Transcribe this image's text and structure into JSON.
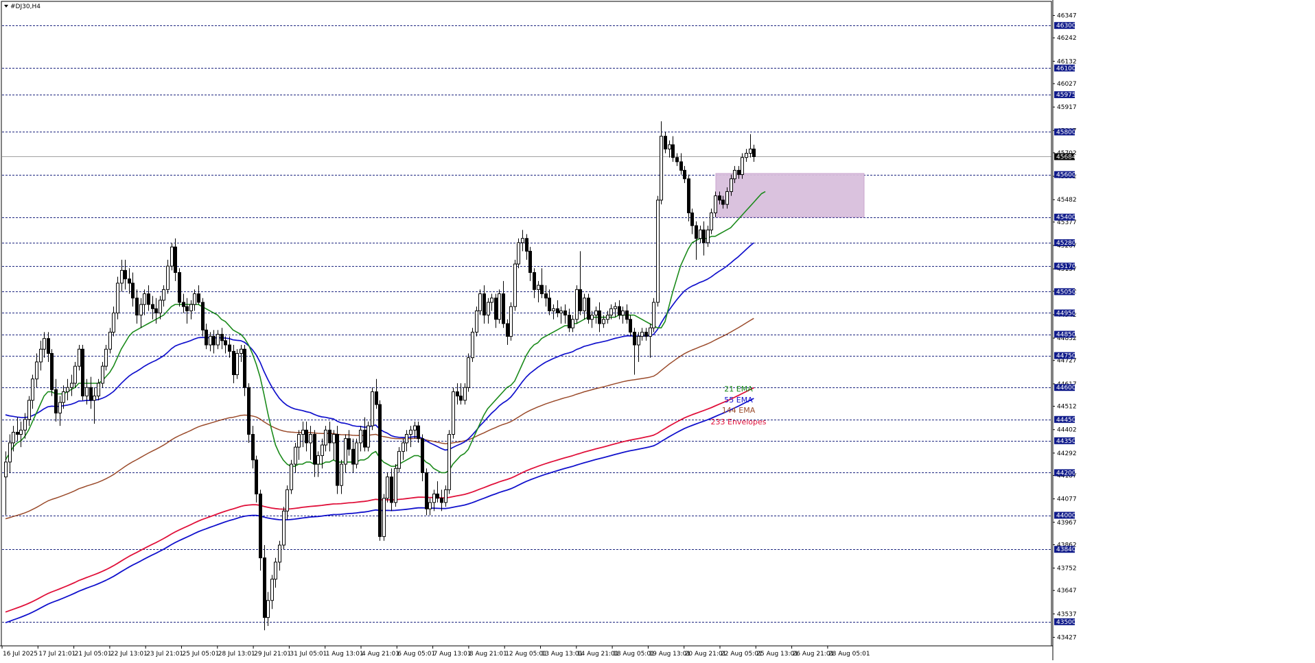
{
  "window": {
    "symbol_title": "#DJ30,H4",
    "menu_icon": "triangle-down-icon"
  },
  "colors": {
    "background": "#ffffff",
    "frame": "#000000",
    "bull_fill": "#ffffff",
    "bear_fill": "#000000",
    "ema21": "#1a8a1a",
    "ema55": "#1010cc",
    "ema144": "#9a4a2a",
    "env233_upper": "#e0103a",
    "env233_lower": "#1010cc",
    "level_line": "#1a237e",
    "level_label_bg": "#0f1a8a",
    "zone_fill": "#d8bfdc",
    "current_price_line": "#a0a0a0"
  },
  "chart_data": {
    "type": "candlestick",
    "title": "#DJ30,H4",
    "ylim": [
      43390,
      46410
    ],
    "y_ticks": [
      46347,
      46242,
      46132,
      46027,
      45917,
      45807,
      45702,
      45592,
      45482,
      45377,
      45267,
      45157,
      45052,
      44942,
      44832,
      44727,
      44617,
      44512,
      44402,
      44292,
      44187,
      44077,
      43967,
      43862,
      43752,
      43647,
      43537,
      43427
    ],
    "levels": [
      46300,
      46100,
      45975,
      45800,
      45600,
      45400,
      45280,
      45170,
      45050,
      44950,
      44850,
      44750,
      44600,
      44450,
      44350,
      44200,
      44000,
      43840,
      43500
    ],
    "current_price": 45684,
    "zone": {
      "from_date": "22 Aug 05:01",
      "to_date": "28 Aug 13:01",
      "low": 45400,
      "high": 45605
    },
    "x_labels": [
      "16 Jul 2025",
      "17 Jul 21:01",
      "21 Jul 05:01",
      "22 Jul 13:01",
      "23 Jul 21:01",
      "25 Jul 05:01",
      "28 Jul 13:01",
      "29 Jul 21:01",
      "31 Jul 05:01",
      "1 Aug 13:01",
      "4 Aug 21:01",
      "6 Aug 05:01",
      "7 Aug 13:01",
      "8 Aug 21:01",
      "12 Aug 05:01",
      "13 Aug 13:01",
      "14 Aug 21:01",
      "18 Aug 05:01",
      "19 Aug 13:01",
      "20 Aug 21:01",
      "22 Aug 05:01",
      "25 Aug 13:01",
      "26 Aug 21:01",
      "28 Aug 05:01"
    ],
    "candles": [
      [
        44180,
        44300,
        44000,
        44250
      ],
      [
        44250,
        44380,
        44200,
        44340
      ],
      [
        44340,
        44420,
        44300,
        44390
      ],
      [
        44390,
        44460,
        44350,
        44380
      ],
      [
        44380,
        44440,
        44320,
        44400
      ],
      [
        44400,
        44480,
        44360,
        44450
      ],
      [
        44450,
        44560,
        44420,
        44540
      ],
      [
        44540,
        44660,
        44500,
        44640
      ],
      [
        44640,
        44760,
        44600,
        44720
      ],
      [
        44720,
        44820,
        44680,
        44780
      ],
      [
        44780,
        44860,
        44740,
        44830
      ],
      [
        44830,
        44860,
        44720,
        44760
      ],
      [
        44760,
        44780,
        44560,
        44590
      ],
      [
        44590,
        44640,
        44440,
        44480
      ],
      [
        44480,
        44560,
        44420,
        44530
      ],
      [
        44530,
        44610,
        44500,
        44580
      ],
      [
        44580,
        44640,
        44540,
        44600
      ],
      [
        44600,
        44660,
        44560,
        44620
      ],
      [
        44620,
        44720,
        44600,
        44700
      ],
      [
        44700,
        44800,
        44680,
        44780
      ],
      [
        44780,
        44800,
        44540,
        44560
      ],
      [
        44560,
        44640,
        44520,
        44600
      ],
      [
        44600,
        44650,
        44500,
        44540
      ],
      [
        44540,
        44600,
        44430,
        44560
      ],
      [
        44560,
        44640,
        44540,
        44620
      ],
      [
        44620,
        44720,
        44600,
        44700
      ],
      [
        44700,
        44800,
        44680,
        44780
      ],
      [
        44780,
        44880,
        44760,
        44860
      ],
      [
        44860,
        44980,
        44840,
        44950
      ],
      [
        44950,
        45120,
        44920,
        45090
      ],
      [
        45090,
        45200,
        45050,
        45150
      ],
      [
        45150,
        45200,
        45060,
        45110
      ],
      [
        45110,
        45160,
        45040,
        45090
      ],
      [
        45090,
        45140,
        44980,
        45020
      ],
      [
        45020,
        45060,
        44900,
        44940
      ],
      [
        44940,
        45020,
        44880,
        44990
      ],
      [
        44990,
        45060,
        44940,
        45040
      ],
      [
        45040,
        45080,
        44960,
        44990
      ],
      [
        44990,
        45030,
        44920,
        44970
      ],
      [
        44970,
        45020,
        44900,
        44950
      ],
      [
        44950,
        45030,
        44920,
        45010
      ],
      [
        45010,
        45080,
        44980,
        45060
      ],
      [
        45060,
        45200,
        45040,
        45170
      ],
      [
        45170,
        45280,
        45150,
        45260
      ],
      [
        45260,
        45300,
        45100,
        45140
      ],
      [
        45140,
        45160,
        44980,
        45000
      ],
      [
        45000,
        45040,
        44950,
        44980
      ],
      [
        44980,
        45020,
        44900,
        44960
      ],
      [
        44960,
        45010,
        44920,
        44990
      ],
      [
        44990,
        45060,
        44960,
        45040
      ],
      [
        45040,
        45080,
        44990,
        45000
      ],
      [
        45000,
        45020,
        44840,
        44870
      ],
      [
        44870,
        44900,
        44780,
        44800
      ],
      [
        44800,
        44860,
        44770,
        44840
      ],
      [
        44840,
        44870,
        44760,
        44800
      ],
      [
        44800,
        44870,
        44780,
        44850
      ],
      [
        44850,
        44880,
        44780,
        44820
      ],
      [
        44820,
        44840,
        44760,
        44800
      ],
      [
        44800,
        44840,
        44740,
        44770
      ],
      [
        44770,
        44800,
        44620,
        44660
      ],
      [
        44660,
        44780,
        44640,
        44760
      ],
      [
        44760,
        44800,
        44720,
        44780
      ],
      [
        44780,
        44800,
        44560,
        44600
      ],
      [
        44600,
        44620,
        44340,
        44380
      ],
      [
        44380,
        44420,
        44220,
        44260
      ],
      [
        44260,
        44280,
        44060,
        44100
      ],
      [
        44100,
        44120,
        43740,
        43800
      ],
      [
        43800,
        43860,
        43460,
        43520
      ],
      [
        43520,
        43640,
        43480,
        43600
      ],
      [
        43600,
        43720,
        43560,
        43700
      ],
      [
        43700,
        43800,
        43660,
        43780
      ],
      [
        43780,
        43880,
        43740,
        43860
      ],
      [
        43860,
        44040,
        43840,
        44020
      ],
      [
        44020,
        44140,
        43980,
        44120
      ],
      [
        44120,
        44260,
        44100,
        44240
      ],
      [
        44240,
        44340,
        44200,
        44320
      ],
      [
        44320,
        44400,
        44260,
        44380
      ],
      [
        44380,
        44440,
        44320,
        44400
      ],
      [
        44400,
        44440,
        44300,
        44340
      ],
      [
        44340,
        44420,
        44260,
        44380
      ],
      [
        44380,
        44400,
        44180,
        44240
      ],
      [
        44240,
        44300,
        44180,
        44280
      ],
      [
        44280,
        44360,
        44220,
        44330
      ],
      [
        44330,
        44420,
        44300,
        44400
      ],
      [
        44400,
        44440,
        44300,
        44340
      ],
      [
        44340,
        44400,
        44260,
        44380
      ],
      [
        44380,
        44420,
        44100,
        44140
      ],
      [
        44140,
        44260,
        44100,
        44240
      ],
      [
        44240,
        44380,
        44200,
        44360
      ],
      [
        44360,
        44400,
        44280,
        44310
      ],
      [
        44310,
        44360,
        44200,
        44240
      ],
      [
        44240,
        44360,
        44220,
        44340
      ],
      [
        44340,
        44420,
        44300,
        44400
      ],
      [
        44400,
        44460,
        44300,
        44320
      ],
      [
        44320,
        44440,
        44300,
        44420
      ],
      [
        44420,
        44600,
        44400,
        44580
      ],
      [
        44580,
        44640,
        44500,
        44520
      ],
      [
        44520,
        44540,
        43880,
        43900
      ],
      [
        43900,
        44100,
        43880,
        44080
      ],
      [
        44080,
        44200,
        44060,
        44180
      ],
      [
        44180,
        44220,
        44020,
        44060
      ],
      [
        44060,
        44240,
        44040,
        44220
      ],
      [
        44220,
        44320,
        44200,
        44300
      ],
      [
        44300,
        44360,
        44260,
        44340
      ],
      [
        44340,
        44400,
        44300,
        44380
      ],
      [
        44380,
        44420,
        44320,
        44400
      ],
      [
        44400,
        44440,
        44360,
        44420
      ],
      [
        44420,
        44440,
        44340,
        44360
      ],
      [
        44360,
        44380,
        44160,
        44200
      ],
      [
        44200,
        44220,
        44000,
        44030
      ],
      [
        44030,
        44080,
        44000,
        44060
      ],
      [
        44060,
        44120,
        44020,
        44100
      ],
      [
        44100,
        44160,
        44060,
        44080
      ],
      [
        44080,
        44120,
        44020,
        44060
      ],
      [
        44060,
        44140,
        44040,
        44120
      ],
      [
        44120,
        44400,
        44100,
        44380
      ],
      [
        44380,
        44600,
        44360,
        44580
      ],
      [
        44580,
        44620,
        44520,
        44560
      ],
      [
        44560,
        44620,
        44520,
        44540
      ],
      [
        44540,
        44620,
        44520,
        44600
      ],
      [
        44600,
        44760,
        44580,
        44740
      ],
      [
        44740,
        44880,
        44720,
        44860
      ],
      [
        44860,
        44980,
        44840,
        44960
      ],
      [
        44960,
        45060,
        44940,
        45040
      ],
      [
        45040,
        45080,
        44900,
        44940
      ],
      [
        44940,
        45020,
        44900,
        45000
      ],
      [
        45000,
        45040,
        44960,
        45020
      ],
      [
        45020,
        45040,
        44880,
        44920
      ],
      [
        44920,
        45060,
        44900,
        45040
      ],
      [
        45040,
        45100,
        44880,
        44900
      ],
      [
        44900,
        44920,
        44800,
        44840
      ],
      [
        44840,
        45000,
        44820,
        44980
      ],
      [
        44980,
        45200,
        44960,
        45180
      ],
      [
        45180,
        45300,
        45160,
        45280
      ],
      [
        45280,
        45340,
        45240,
        45300
      ],
      [
        45300,
        45320,
        45200,
        45240
      ],
      [
        45240,
        45260,
        45100,
        45140
      ],
      [
        45140,
        45160,
        45020,
        45060
      ],
      [
        45060,
        45100,
        45000,
        45080
      ],
      [
        45080,
        45160,
        45020,
        45040
      ],
      [
        45040,
        45080,
        44980,
        45020
      ],
      [
        45020,
        45060,
        44940,
        44960
      ],
      [
        44960,
        44990,
        44920,
        44970
      ],
      [
        44970,
        45010,
        44930,
        44950
      ],
      [
        44950,
        44980,
        44900,
        44960
      ],
      [
        44960,
        44990,
        44900,
        44940
      ],
      [
        44940,
        44970,
        44860,
        44880
      ],
      [
        44880,
        44940,
        44860,
        44920
      ],
      [
        44920,
        45080,
        44900,
        45060
      ],
      [
        45060,
        45240,
        44940,
        44960
      ],
      [
        44960,
        45040,
        44920,
        45020
      ],
      [
        45020,
        45040,
        44900,
        44920
      ],
      [
        44920,
        44960,
        44880,
        44940
      ],
      [
        44940,
        44980,
        44900,
        44960
      ],
      [
        44960,
        45000,
        44860,
        44900
      ],
      [
        44900,
        44940,
        44880,
        44920
      ],
      [
        44920,
        44960,
        44900,
        44940
      ],
      [
        44940,
        44990,
        44920,
        44970
      ],
      [
        44970,
        45000,
        44930,
        44980
      ],
      [
        44980,
        45010,
        44920,
        44940
      ],
      [
        44940,
        44980,
        44900,
        44960
      ],
      [
        44960,
        44990,
        44900,
        44920
      ],
      [
        44920,
        44940,
        44840,
        44860
      ],
      [
        44860,
        44880,
        44660,
        44800
      ],
      [
        44800,
        44860,
        44720,
        44840
      ],
      [
        44840,
        44880,
        44820,
        44860
      ],
      [
        44860,
        44880,
        44820,
        44840
      ],
      [
        44840,
        44900,
        44740,
        44880
      ],
      [
        44880,
        45020,
        44860,
        45000
      ],
      [
        45000,
        45500,
        44980,
        45480
      ],
      [
        45480,
        45850,
        45460,
        45780
      ],
      [
        45780,
        45800,
        45700,
        45720
      ],
      [
        45720,
        45760,
        45680,
        45740
      ],
      [
        45740,
        45780,
        45660,
        45680
      ],
      [
        45680,
        45700,
        45640,
        45660
      ],
      [
        45660,
        45700,
        45600,
        45620
      ],
      [
        45620,
        45640,
        45560,
        45580
      ],
      [
        45580,
        45600,
        45380,
        45420
      ],
      [
        45420,
        45440,
        45320,
        45360
      ],
      [
        45360,
        45380,
        45200,
        45300
      ],
      [
        45300,
        45360,
        45280,
        45340
      ],
      [
        45340,
        45380,
        45220,
        45280
      ],
      [
        45280,
        45360,
        45260,
        45340
      ],
      [
        45340,
        45440,
        45320,
        45420
      ],
      [
        45420,
        45520,
        45400,
        45500
      ],
      [
        45500,
        45520,
        45460,
        45480
      ],
      [
        45480,
        45500,
        45440,
        45460
      ],
      [
        45460,
        45540,
        45440,
        45520
      ],
      [
        45520,
        45600,
        45500,
        45580
      ],
      [
        45580,
        45640,
        45560,
        45620
      ],
      [
        45620,
        45640,
        45580,
        45600
      ],
      [
        45600,
        45700,
        45580,
        45680
      ],
      [
        45680,
        45720,
        45660,
        45700
      ],
      [
        45700,
        45790,
        45680,
        45720
      ],
      [
        45720,
        45740,
        45660,
        45684
      ]
    ],
    "ema21": [
      44260,
      44290,
      44320,
      44340,
      44350,
      44370,
      44400,
      44440,
      44480,
      44520,
      44560,
      44580,
      44580,
      44570,
      44570,
      44570,
      44580,
      44590,
      44600,
      44620,
      44620,
      44620,
      44620,
      44620,
      44620,
      44630,
      44650,
      44670,
      44700,
      44740,
      44780,
      44810,
      44840,
      44860,
      44870,
      44880,
      44890,
      44900,
      44910,
      44920,
      44930,
      44940,
      44960,
      44980,
      44990,
      44990,
      44990,
      44990,
      44990,
      44990,
      44990,
      44980,
      44970,
      44960,
      44950,
      44940,
      44920,
      44910,
      44890,
      44870,
      44860,
      44850,
      44830,
      44800,
      44760,
      44710,
      44650,
      44570,
      44480,
      44400,
      44330,
      44290,
      44260,
      44240,
      44230,
      44230,
      44240,
      44240,
      44250,
      44250,
      44240,
      44240,
      44240,
      44250,
      44250,
      44260,
      44250,
      44250,
      44250,
      44250,
      44250,
      44250,
      44260,
      44260,
      44270,
      44290,
      44300,
      44270,
      44250,
      44240,
      44230,
      44230,
      44240,
      44250,
      44260,
      44270,
      44280,
      44280,
      44270,
      44250,
      44240,
      44220,
      44210,
      44200,
      44200,
      44210,
      44240,
      44260,
      44280,
      44290,
      44310,
      44350,
      44390,
      44430,
      44470,
      44500,
      44520,
      44540,
      44560,
      44580,
      44600,
      44610,
      44630,
      44670,
      44710,
      44750,
      44780,
      44800,
      44810,
      44830,
      44840,
      44850,
      44860,
      44870,
      44880,
      44890,
      44890,
      44900,
      44900,
      44910,
      44920,
      44930,
      44930,
      44930,
      44930,
      44930,
      44930,
      44930,
      44930,
      44940,
      44940,
      44940,
      44940,
      44940,
      44930,
      44920,
      44910,
      44900,
      44890,
      44880,
      44880,
      44910,
      44980,
      45050,
      45110,
      45170,
      45210,
      45250,
      45280,
      45290,
      45300,
      45300,
      45300,
      45310,
      45310,
      45320,
      45330,
      45340,
      45350,
      45370,
      45390,
      45410,
      45430,
      45450,
      45470,
      45490,
      45510,
      45520
    ]
  },
  "legend": [
    {
      "label": "21 EMA",
      "color": "#1a8a1a"
    },
    {
      "label": "55 EMA",
      "color": "#1010cc"
    },
    {
      "label": "144 EMA",
      "color": "#9a4a2a"
    },
    {
      "label": "233 Envelopes",
      "color": "#e0103a"
    }
  ]
}
